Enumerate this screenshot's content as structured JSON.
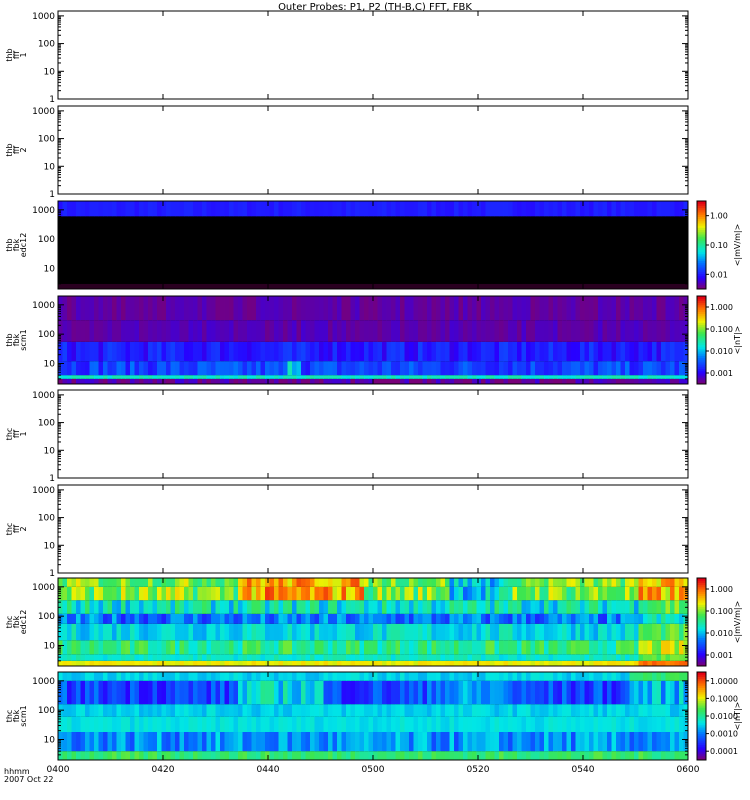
{
  "title": "Outer Probes: P1, P2 (TH-B,C) FFT, FBK",
  "footer": {
    "time_label": "hhmm",
    "date": "2007 Oct 22"
  },
  "colors": {
    "frame": "#000000",
    "black_fill": "#000000",
    "dark_purple": "#2a0020",
    "blue": "#1e1eff",
    "cyan": "#00e5e5",
    "green": "#40e040",
    "yellow": "#f0f000",
    "red": "#e01010"
  },
  "chart_data": [
    {
      "type": "heatmap",
      "name": "thb_fft_1",
      "ylabel": [
        "thb",
        "fff",
        "1"
      ],
      "yscale": "log",
      "ylim": [
        1,
        1500
      ],
      "yticks": [
        "1",
        "10",
        "100",
        "1000"
      ],
      "colorbar": null,
      "fill": "none"
    },
    {
      "type": "heatmap",
      "name": "thb_fft_2",
      "ylabel": [
        "thb",
        "fff",
        "2"
      ],
      "yscale": "log",
      "ylim": [
        1,
        1500
      ],
      "yticks": [
        "1",
        "10",
        "100",
        "1000"
      ],
      "colorbar": null,
      "fill": "none"
    },
    {
      "type": "heatmap",
      "name": "thb_fbk_edc12",
      "ylabel": [
        "thb",
        "fbk",
        "edc12"
      ],
      "yscale": "log",
      "ylim": [
        2,
        2000
      ],
      "yticks": [
        "10",
        "100",
        "1000"
      ],
      "colorbar": {
        "label": "<|mV/m|>",
        "ticks": [
          "0.01",
          "0.10",
          "1.00"
        ]
      },
      "fill": "edc12_b"
    },
    {
      "type": "heatmap",
      "name": "thb_fbk_scm1",
      "ylabel": [
        "thb",
        "fbk",
        "scm1"
      ],
      "yscale": "log",
      "ylim": [
        2,
        2000
      ],
      "yticks": [
        "10",
        "100",
        "1000"
      ],
      "colorbar": {
        "label": "<|nT|>",
        "ticks": [
          "0.001",
          "0.010",
          "0.100",
          "1.000"
        ]
      },
      "fill": "scm1_b"
    },
    {
      "type": "heatmap",
      "name": "thc_fft_1",
      "ylabel": [
        "thc",
        "fff",
        "1"
      ],
      "yscale": "log",
      "ylim": [
        1,
        1500
      ],
      "yticks": [
        "1",
        "10",
        "100",
        "1000"
      ],
      "colorbar": null,
      "fill": "none"
    },
    {
      "type": "heatmap",
      "name": "thc_fft_2",
      "ylabel": [
        "thc",
        "fff",
        "2"
      ],
      "yscale": "log",
      "ylim": [
        1,
        1500
      ],
      "yticks": [
        "1",
        "10",
        "100",
        "1000"
      ],
      "colorbar": null,
      "fill": "none"
    },
    {
      "type": "heatmap",
      "name": "thc_fbk_edc12",
      "ylabel": [
        "thc",
        "fbk",
        "edc12"
      ],
      "yscale": "log",
      "ylim": [
        2,
        2000
      ],
      "yticks": [
        "10",
        "100",
        "1000"
      ],
      "colorbar": {
        "label": "<|mV/m|>",
        "ticks": [
          "0.001",
          "0.010",
          "0.100",
          "1.000"
        ]
      },
      "fill": "edc12_c"
    },
    {
      "type": "heatmap",
      "name": "thc_fbk_scm1",
      "ylabel": [
        "thc",
        "fbk",
        "scm1"
      ],
      "yscale": "log",
      "ylim": [
        2,
        2000
      ],
      "yticks": [
        "10",
        "100",
        "1000"
      ],
      "colorbar": {
        "label": "<|nT|>",
        "ticks": [
          "0.0001",
          "0.0010",
          "0.0100",
          "0.1000",
          "1.0000"
        ]
      },
      "fill": "scm1_c"
    }
  ],
  "xaxis": {
    "ticks": [
      "0400",
      "0420",
      "0440",
      "0500",
      "0520",
      "0540",
      "0600"
    ],
    "xlim": [
      "04:00",
      "06:00"
    ]
  }
}
